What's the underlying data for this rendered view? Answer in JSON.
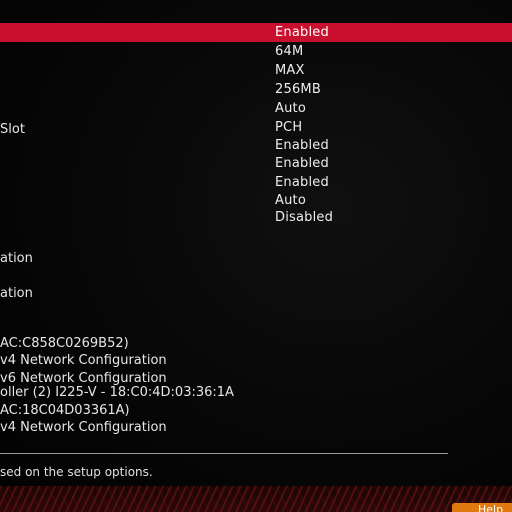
{
  "settings_values": [
    "Enabled",
    "64M",
    "MAX",
    "256MB",
    "Auto",
    "PCH",
    "Enabled",
    "Enabled",
    "Enabled",
    "Auto",
    "Disabled"
  ],
  "labels": {
    "slot": "Slot",
    "configuration_1": "ation",
    "configuration_2": "ation"
  },
  "network": {
    "mac_1": "AC:C858C0269B52)",
    "ipv4_1": "v4 Network Configuration",
    "ipv6_1": "v6 Network Configuration",
    "controller_2": "oller (2) I225-V - 18:C0:4D:03:36:1A",
    "mac_2": "AC:18C04D03361A)",
    "ipv4_2": "v4 Network Configuration"
  },
  "help_text": "sed on the setup options.",
  "help_button_label": "Help",
  "colors": {
    "highlight": "#c8102e",
    "help_button": "#e07a10"
  }
}
